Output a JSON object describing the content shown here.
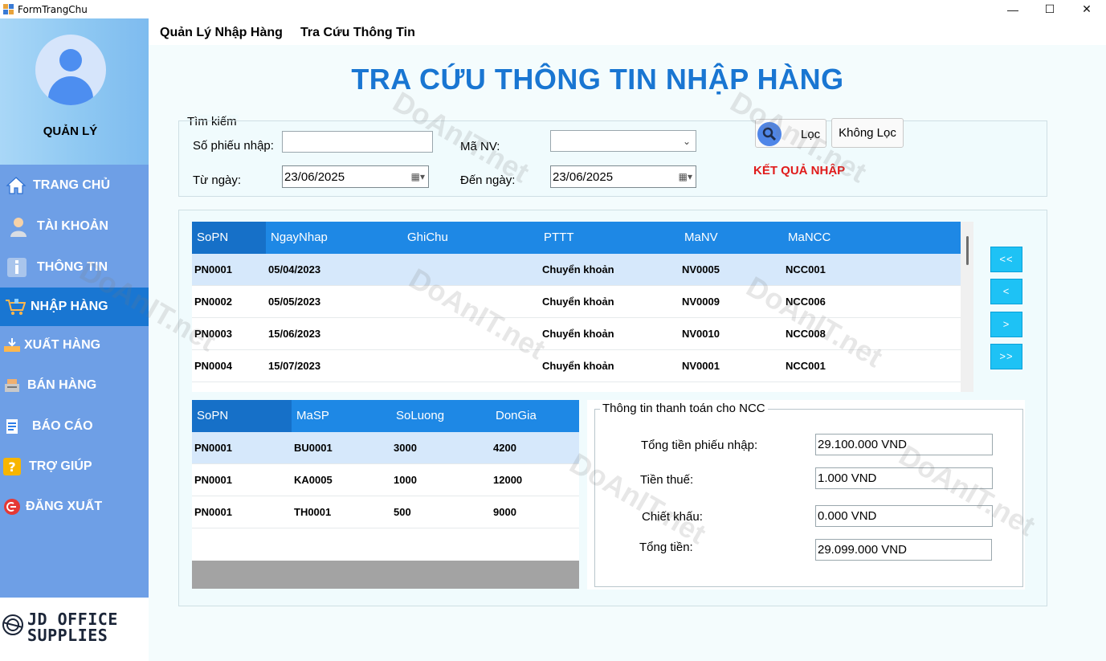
{
  "window": {
    "title": "FormTrangChu",
    "controls": {
      "minimize": "—",
      "maximize": "☐",
      "close": "✕"
    }
  },
  "sidebar": {
    "role": "QUẢN LÝ",
    "items": [
      {
        "label": "TRANG CHỦ",
        "icon": "home-icon"
      },
      {
        "label": "TÀI KHOẢN",
        "icon": "user-icon"
      },
      {
        "label": "THÔNG TIN",
        "icon": "info-icon"
      },
      {
        "label": "NHẬP HÀNG",
        "icon": "cart-icon",
        "active": true
      },
      {
        "label": "XUẤT HÀNG",
        "icon": "export-icon"
      },
      {
        "label": "BÁN HÀNG",
        "icon": "register-icon"
      },
      {
        "label": "BÁO CÁO",
        "icon": "report-icon"
      },
      {
        "label": "TRỢ GIÚP",
        "icon": "help-icon"
      },
      {
        "label": "ĐĂNG XUẤT",
        "icon": "logout-icon"
      }
    ],
    "logo": {
      "line1": "JD OFFICE",
      "line2": "SUPPLIES"
    }
  },
  "menubar": {
    "items": [
      "Quản Lý Nhập Hàng",
      "Tra Cứu Thông Tin"
    ]
  },
  "page": {
    "title": "TRA CỨU THÔNG TIN NHẬP HÀNG"
  },
  "search": {
    "legend": "Tìm kiếm",
    "so_phieu_label": "Số phiếu nhập:",
    "so_phieu_value": "",
    "ma_nv_label": "Mã NV:",
    "ma_nv_value": "",
    "tu_ngay_label": "Từ ngày:",
    "tu_ngay_value": "23/06/2025",
    "den_ngay_label": "Đến ngày:",
    "den_ngay_value": "23/06/2025",
    "loc_button": "Lọc",
    "khong_loc_button": "Không Lọc",
    "ket_qua": "KẾT QUẢ NHẬP"
  },
  "grid_phieu": {
    "columns": [
      "SoPN",
      "NgayNhap",
      "GhiChu",
      "PTTT",
      "MaNV",
      "MaNCC"
    ],
    "rows": [
      [
        "PN0001",
        "05/04/2023",
        "",
        "Chuyển khoản",
        "NV0005",
        "NCC001"
      ],
      [
        "PN0002",
        "05/05/2023",
        "",
        "Chuyển khoản",
        "NV0009",
        "NCC006"
      ],
      [
        "PN0003",
        "15/06/2023",
        "",
        "Chuyển khoản",
        "NV0010",
        "NCC008"
      ],
      [
        "PN0004",
        "15/07/2023",
        "",
        "Chuyển khoản",
        "NV0001",
        "NCC001"
      ]
    ]
  },
  "nav": {
    "first": "<<",
    "prev": "<",
    "next": ">",
    "last": ">>"
  },
  "grid_chitiet": {
    "columns": [
      "SoPN",
      "MaSP",
      "SoLuong",
      "DonGia"
    ],
    "rows": [
      [
        "PN0001",
        "BU0001",
        "3000",
        "4200"
      ],
      [
        "PN0001",
        "KA0005",
        "1000",
        "12000"
      ],
      [
        "PN0001",
        "TH0001",
        "500",
        "9000"
      ]
    ]
  },
  "payment": {
    "legend": "Thông tin thanh toán cho NCC",
    "tong_phieu_label": "Tổng tiền phiếu nhập:",
    "tong_phieu_value": "29.100.000 VND",
    "thue_label": "Tiền thuế:",
    "thue_value": "1.000 VND",
    "chiet_khau_label": "Chiết khấu:",
    "chiet_khau_value": "0.000 VND",
    "tong_tien_label": "Tổng tiền:",
    "tong_tien_value": "29.099.000 VND"
  },
  "watermark": "DoAnIT.net",
  "colors": {
    "accent": "#1976d2",
    "grid_header": "#1e88e5",
    "sidebar": "#6e9fe6",
    "nav_button": "#1ec2f5",
    "alert": "#e01b1b"
  }
}
